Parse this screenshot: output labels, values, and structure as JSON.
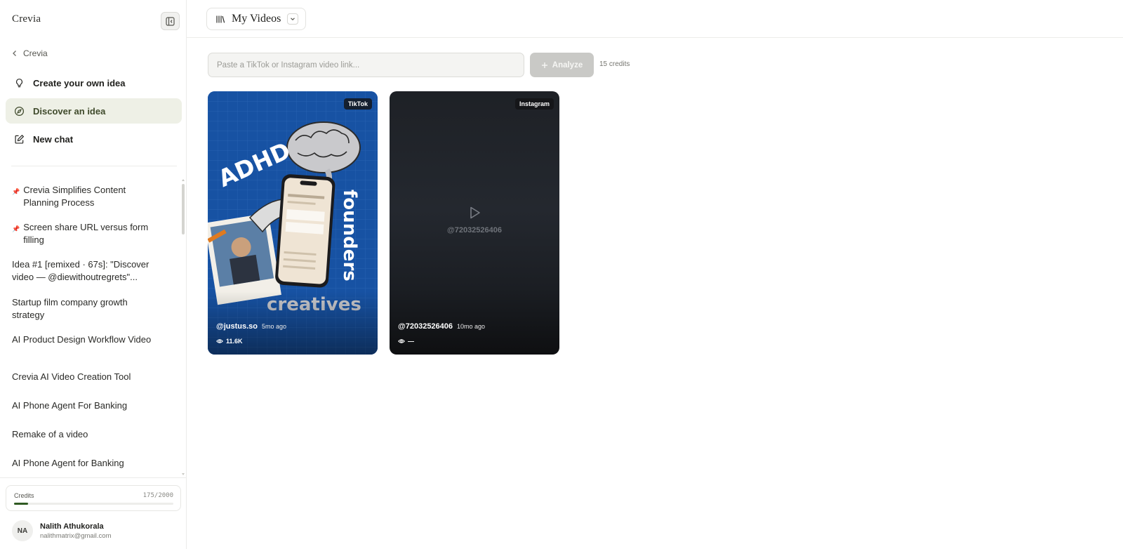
{
  "app": {
    "logo": "Crevia",
    "back_label": "Crevia"
  },
  "sidebar": {
    "nav": [
      {
        "label": "Create your own idea",
        "icon": "lightbulb-icon",
        "active": false
      },
      {
        "label": "Discover an idea",
        "icon": "compass-icon",
        "active": true
      },
      {
        "label": "New chat",
        "icon": "edit-icon",
        "active": false
      }
    ],
    "history": [
      {
        "label": "Crevia Simplifies Content Planning Process",
        "pinned": true
      },
      {
        "label": "Screen share URL versus form filling",
        "pinned": true
      },
      {
        "label": "Idea #1 [remixed · 67s]: \"Discover video — @diewithoutregrets\"...",
        "pinned": false
      },
      {
        "label": "Startup film company growth strategy",
        "pinned": false
      },
      {
        "label": "AI Product Design Workflow Video",
        "pinned": false
      },
      {
        "label": "Crevia AI Video Creation Tool",
        "pinned": false
      },
      {
        "label": "AI Phone Agent For Banking",
        "pinned": false
      },
      {
        "label": "Remake of a video",
        "pinned": false
      },
      {
        "label": "AI Phone Agent for Banking",
        "pinned": false
      }
    ],
    "credits": {
      "label": "Credits",
      "count": "175/2000",
      "used_fraction": 0.0875
    },
    "user": {
      "initials": "NA",
      "name": "Nalith Athukorala",
      "email": "nalithmatrix@gmail.com"
    }
  },
  "header": {
    "title": "My Videos"
  },
  "main": {
    "input_placeholder": "Paste a TikTok or Instagram video link...",
    "analyze_label": "Analyze",
    "credits_text": "15 credits",
    "videos": [
      {
        "platform": "TikTok",
        "handle": "@justus.so",
        "age": "5mo ago",
        "views": "11.6K",
        "thumb_text": {
          "a": "ADHD",
          "b": "founders",
          "c": "creatives"
        }
      },
      {
        "platform": "Instagram",
        "handle": "@72032526406",
        "age": "10mo ago",
        "views": "—",
        "placeholder_handle": "@72032526406"
      }
    ]
  },
  "colors": {
    "accent": "#3f4a2b",
    "active_bg": "#eef0e6",
    "credits_fill": "#2f5a22",
    "tiktok_bg": "#1d5fb8"
  }
}
